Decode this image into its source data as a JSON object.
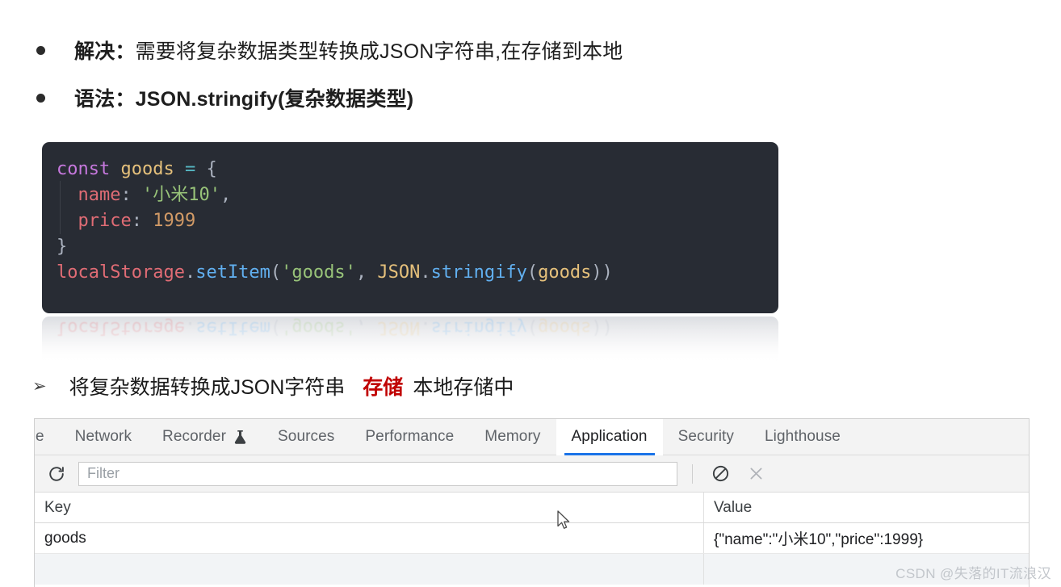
{
  "slide": {
    "bullets": [
      {
        "lead": "解决：",
        "body": "需要将复杂数据类型转换成JSON字符串,在存储到本地",
        "bold_body": false
      },
      {
        "lead": "语法：",
        "body": "JSON.stringify(复杂数据类型)",
        "bold_body": true
      }
    ],
    "arrow_note": {
      "marker": "➢",
      "before": "将复杂数据转换成JSON字符串",
      "highlight": "存储",
      "highlight_color": "#c00000",
      "after": "本地存储中"
    }
  },
  "code": {
    "background": "#282c34",
    "lines": [
      [
        {
          "t": "const",
          "c": "tk-kw"
        },
        {
          "t": " ",
          "c": "tk-punc"
        },
        {
          "t": "goods",
          "c": "tk-var"
        },
        {
          "t": " ",
          "c": "tk-punc"
        },
        {
          "t": "=",
          "c": "tk-op"
        },
        {
          "t": " ",
          "c": "tk-punc"
        },
        {
          "t": "{",
          "c": "tk-punc"
        }
      ],
      [
        {
          "t": "  ",
          "c": "tk-punc"
        },
        {
          "t": "name",
          "c": "tk-prop"
        },
        {
          "t": ": ",
          "c": "tk-punc"
        },
        {
          "t": "'小米10'",
          "c": "tk-str"
        },
        {
          "t": ",",
          "c": "tk-punc"
        }
      ],
      [
        {
          "t": "  ",
          "c": "tk-punc"
        },
        {
          "t": "price",
          "c": "tk-prop"
        },
        {
          "t": ": ",
          "c": "tk-punc"
        },
        {
          "t": "1999",
          "c": "tk-num"
        }
      ],
      [
        {
          "t": "}",
          "c": "tk-punc"
        }
      ],
      [
        {
          "t": "localStorage",
          "c": "tk-obj"
        },
        {
          "t": ".",
          "c": "tk-punc"
        },
        {
          "t": "setItem",
          "c": "tk-fn"
        },
        {
          "t": "(",
          "c": "tk-punc"
        },
        {
          "t": "'goods'",
          "c": "tk-str"
        },
        {
          "t": ", ",
          "c": "tk-punc"
        },
        {
          "t": "JSON",
          "c": "tk-class"
        },
        {
          "t": ".",
          "c": "tk-punc"
        },
        {
          "t": "stringify",
          "c": "tk-fn"
        },
        {
          "t": "(",
          "c": "tk-punc"
        },
        {
          "t": "goods",
          "c": "tk-var"
        },
        {
          "t": "))",
          "c": "tk-punc"
        }
      ]
    ],
    "reflection_line_index": 4
  },
  "devtools": {
    "tabs": [
      {
        "label": "ole",
        "active": false,
        "cut": true,
        "icon": null
      },
      {
        "label": "Network",
        "active": false,
        "cut": false,
        "icon": null
      },
      {
        "label": "Recorder",
        "active": false,
        "cut": false,
        "icon": "flask-icon"
      },
      {
        "label": "Sources",
        "active": false,
        "cut": false,
        "icon": null
      },
      {
        "label": "Performance",
        "active": false,
        "cut": false,
        "icon": null
      },
      {
        "label": "Memory",
        "active": false,
        "cut": false,
        "icon": null
      },
      {
        "label": "Application",
        "active": true,
        "cut": false,
        "icon": null
      },
      {
        "label": "Security",
        "active": false,
        "cut": false,
        "icon": null
      },
      {
        "label": "Lighthouse",
        "active": false,
        "cut": false,
        "icon": null
      }
    ],
    "active_tab": "Application",
    "active_underline_color": "#1a73e8",
    "toolbar": {
      "refresh_icon": "refresh-icon",
      "filter_placeholder": "Filter",
      "filter_value": "",
      "clear_icon": "no-entry-icon",
      "close_icon": "close-icon"
    },
    "table": {
      "columns": [
        "Key",
        "Value"
      ],
      "rows": [
        {
          "key": "goods",
          "value": "{\"name\":\"小米10\",\"price\":1999}"
        }
      ],
      "empty_stripe_row": true
    }
  },
  "watermark": "CSDN @失落的IT流浪汉"
}
